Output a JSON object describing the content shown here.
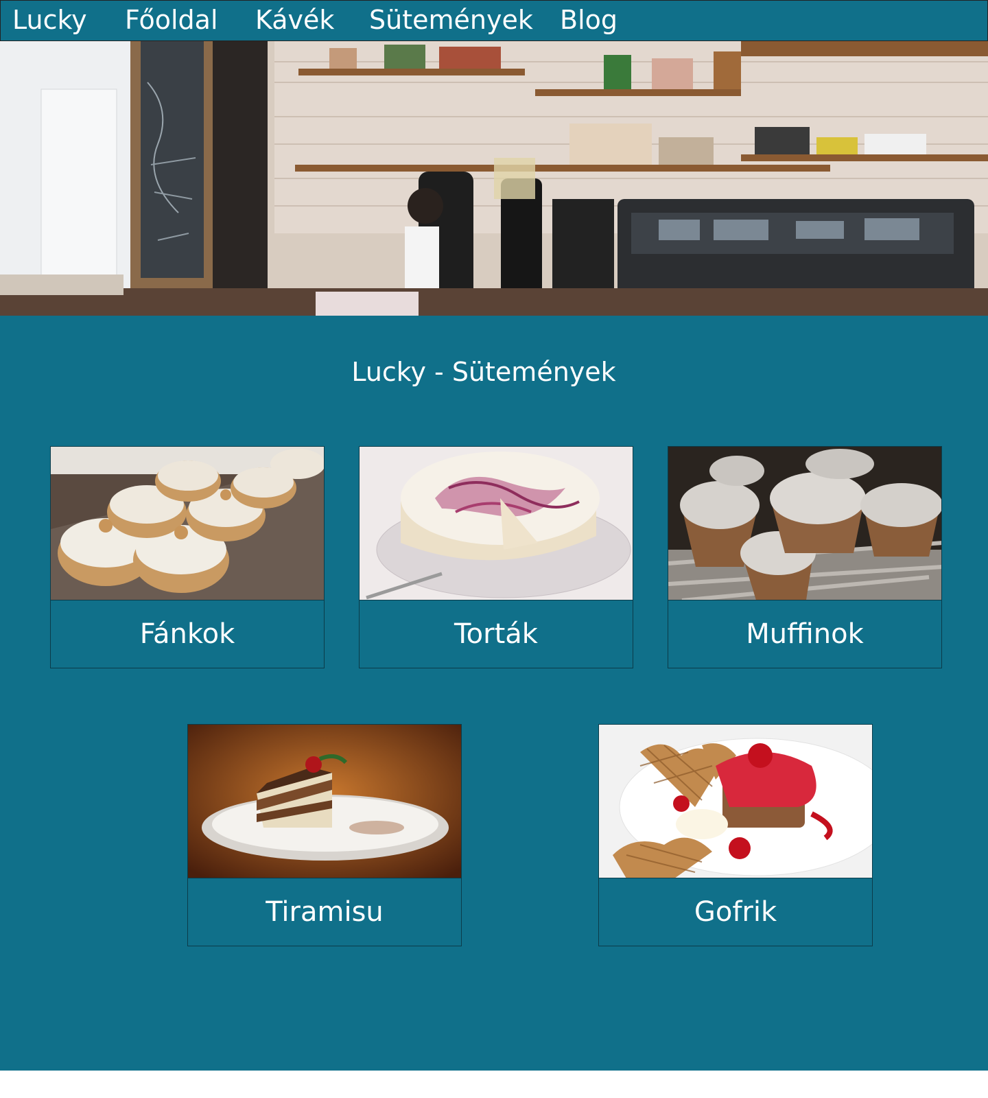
{
  "nav": {
    "brand": "Lucky",
    "links": [
      "Főoldal",
      "Kávék",
      "Sütemények",
      "Blog"
    ]
  },
  "hero": {
    "image": "cafe-counter-photo"
  },
  "main": {
    "title": "Lucky - Sütemények",
    "cards": [
      {
        "label": "Fánkok",
        "image": "donuts-photo"
      },
      {
        "label": "Torták",
        "image": "cheesecake-photo"
      },
      {
        "label": "Muffinok",
        "image": "muffins-photo"
      },
      {
        "label": "Tiramisu",
        "image": "tiramisu-photo"
      },
      {
        "label": "Gofrik",
        "image": "waffles-photo"
      }
    ]
  },
  "colors": {
    "primary": "#10708a",
    "text": "#ffffff",
    "border": "#0b3b49"
  }
}
